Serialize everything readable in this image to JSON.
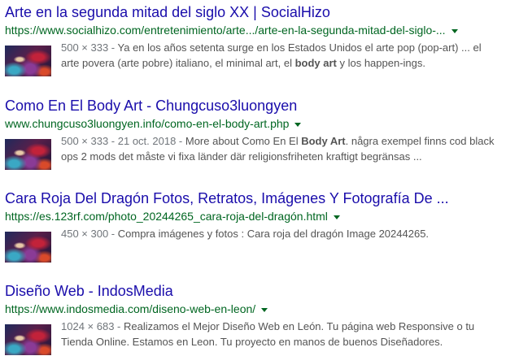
{
  "results": [
    {
      "title": "Arte en la segunda mitad del siglo XX | SocialHizo",
      "url": "https://www.socialhizo.com/entretenimiento/arte.../arte-en-la-segunda-mitad-del-siglo-...",
      "meta": "500 × 333 - ",
      "snippet_a": "Ya en los años setenta surge en los Estados Unidos el arte pop (pop-art) ... el arte povera (arte pobre) italiano, el minimal art, el ",
      "snippet_bold": "body art",
      "snippet_b": " y los happen-ings."
    },
    {
      "title": "Como En El Body Art - Chungcuso3luongyen",
      "url": "www.chungcuso3luongyen.info/como-en-el-body-art.php",
      "meta": "500 × 333 - 21 oct. 2018 - ",
      "snippet_a": "More about Como En El ",
      "snippet_bold": "Body Art",
      "snippet_b": ". några exempel finns cod black ops 2 mods det måste vi fixa länder där religionsfriheten kraftigt begränsas ..."
    },
    {
      "title": "Cara Roja Del Dragón Fotos, Retratos, Imágenes Y Fotografía De ...",
      "url": "https://es.123rf.com/photo_20244265_cara-roja-del-dragón.html",
      "meta": "450 × 300 - ",
      "snippet_a": "Compra imágenes y fotos : Cara roja del dragón Image 20244265.",
      "snippet_bold": "",
      "snippet_b": ""
    },
    {
      "title": "Diseño Web - IndosMedia",
      "url": "https://www.indosmedia.com/diseno-web-en-leon/",
      "meta": "1024 × 683 - ",
      "snippet_a": "Realizamos el Mejor Diseño Web en León. Tu página web Responsive o tu Tienda Online. Estamos en Leon. Tu proyecto en manos de buenos Diseñadores.",
      "snippet_bold": "",
      "snippet_b": ""
    }
  ],
  "colors": {
    "title": "#1a0dab",
    "url": "#006621",
    "snippet": "#545454"
  }
}
